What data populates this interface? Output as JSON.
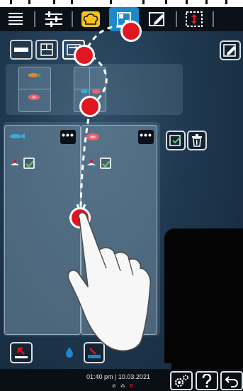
{
  "toolbar": {
    "items": [
      {
        "name": "menu-icon"
      },
      {
        "name": "filter-settings-icon"
      },
      {
        "name": "chef-hat-icon"
      },
      {
        "name": "arrange-trays-icon",
        "active": true
      },
      {
        "name": "edit-icon"
      },
      {
        "name": "resize-icon"
      }
    ]
  },
  "view_modes": [
    {
      "name": "single-view-icon"
    },
    {
      "name": "grid-view-icon"
    },
    {
      "name": "tray-view-icon",
      "active": true
    }
  ],
  "columns": [
    {
      "icon": "fish-icon",
      "more_label": "•••"
    },
    {
      "icon": "meat-icon",
      "more_label": "•••"
    }
  ],
  "footer": {
    "time": "01:40 pm",
    "date": "10.03.2021",
    "separator": "|"
  },
  "colors": {
    "accent": "#1e89c9",
    "drag_marker": "#e01721",
    "check": "#6dc46a"
  }
}
